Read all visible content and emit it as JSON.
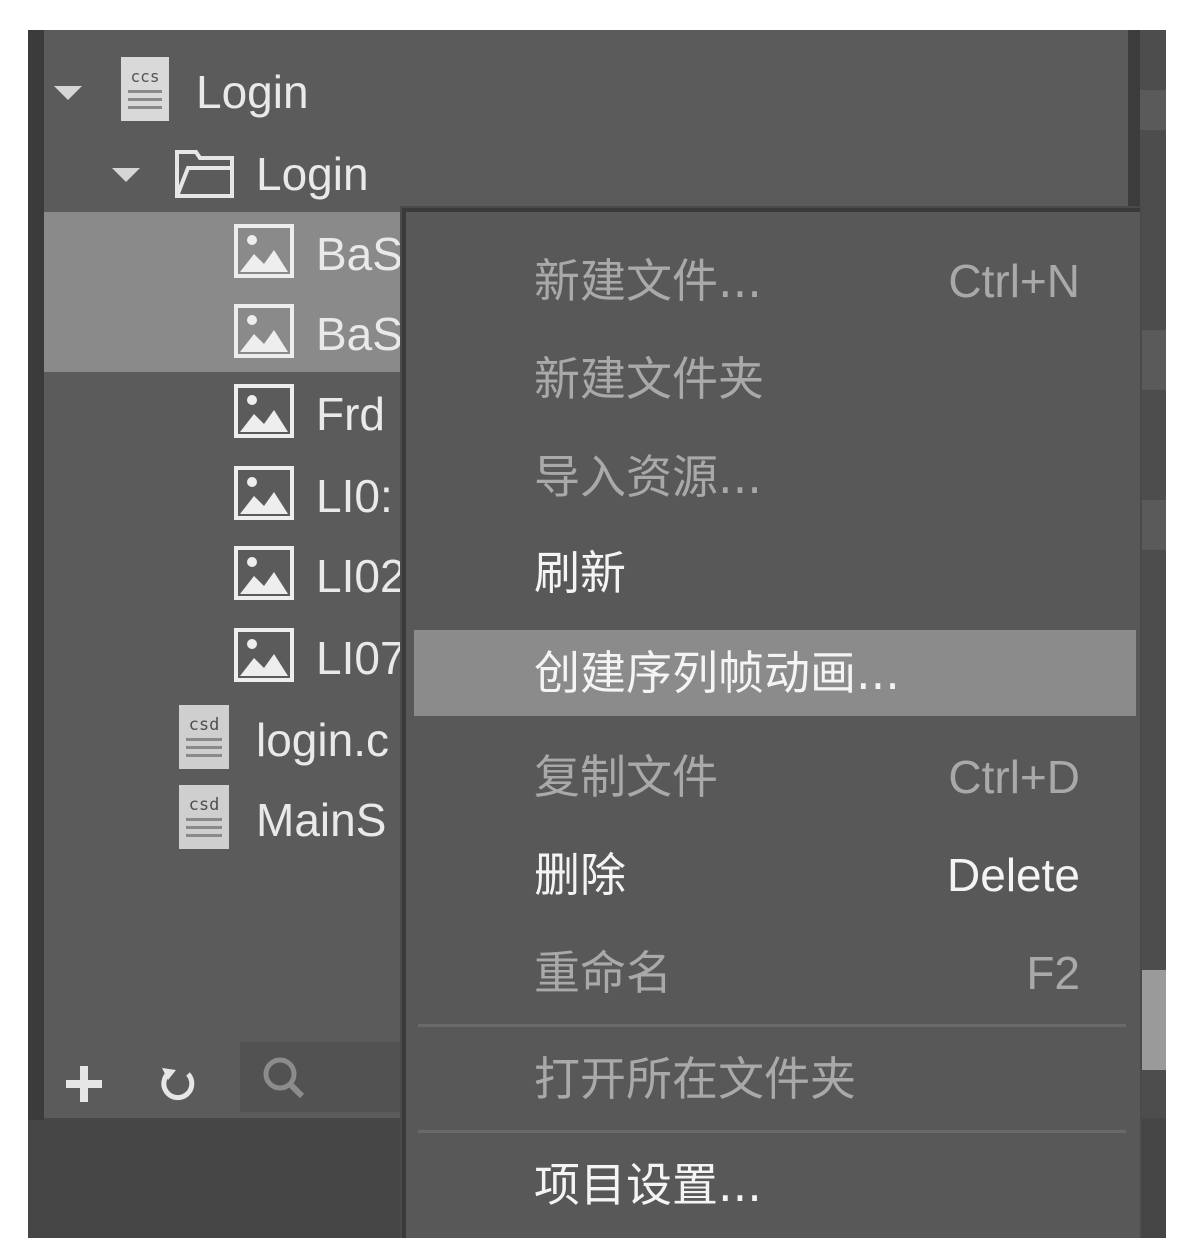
{
  "tree": {
    "root": {
      "label": "Login",
      "icon": "ccs-file-icon"
    },
    "folder": {
      "label": "Login",
      "icon": "folder-icon"
    },
    "images": [
      {
        "label": "BaS",
        "icon": "image-file-icon",
        "selected": true
      },
      {
        "label": "BaS",
        "icon": "image-file-icon",
        "selected": true
      },
      {
        "label": "Frd",
        "icon": "image-file-icon",
        "selected": false
      },
      {
        "label": "LI0:",
        "icon": "image-file-icon",
        "selected": false
      },
      {
        "label": "LI02",
        "icon": "image-file-icon",
        "selected": false
      },
      {
        "label": "LI07",
        "icon": "image-file-icon",
        "selected": false
      }
    ],
    "csd_files": [
      {
        "label": "login.c",
        "icon": "csd-file-icon"
      },
      {
        "label": "MainS",
        "icon": "csd-file-icon"
      }
    ],
    "icon_texts": {
      "ccs": "ccs",
      "csd": "csd"
    }
  },
  "toolbar": {
    "add_icon": "plus-icon",
    "refresh_icon": "refresh-icon",
    "search_icon": "search-icon"
  },
  "context_menu": {
    "items": [
      {
        "label": "新建文件...",
        "shortcut": "Ctrl+N",
        "enabled": false
      },
      {
        "label": "新建文件夹",
        "shortcut": "",
        "enabled": false
      },
      {
        "label": "导入资源...",
        "shortcut": "",
        "enabled": false
      },
      {
        "label": "刷新",
        "shortcut": "",
        "enabled": true
      },
      {
        "label": "创建序列帧动画...",
        "shortcut": "",
        "enabled": true,
        "highlighted": true
      },
      {
        "label": "复制文件",
        "shortcut": "Ctrl+D",
        "enabled": false
      },
      {
        "label": "删除",
        "shortcut": "Delete",
        "enabled": true
      },
      {
        "label": "重命名",
        "shortcut": "F2",
        "enabled": false
      },
      {
        "label": "打开所在文件夹",
        "shortcut": "",
        "enabled": false
      },
      {
        "label": "项目设置...",
        "shortcut": "",
        "enabled": true
      }
    ]
  },
  "colors": {
    "panel": "#5b5b5b",
    "selection": "#8a8a8a",
    "menu": "#585858",
    "menu_highlight": "#8b8b8b",
    "text_enabled": "#f4f4f4",
    "text_disabled": "#a9a9a9"
  }
}
